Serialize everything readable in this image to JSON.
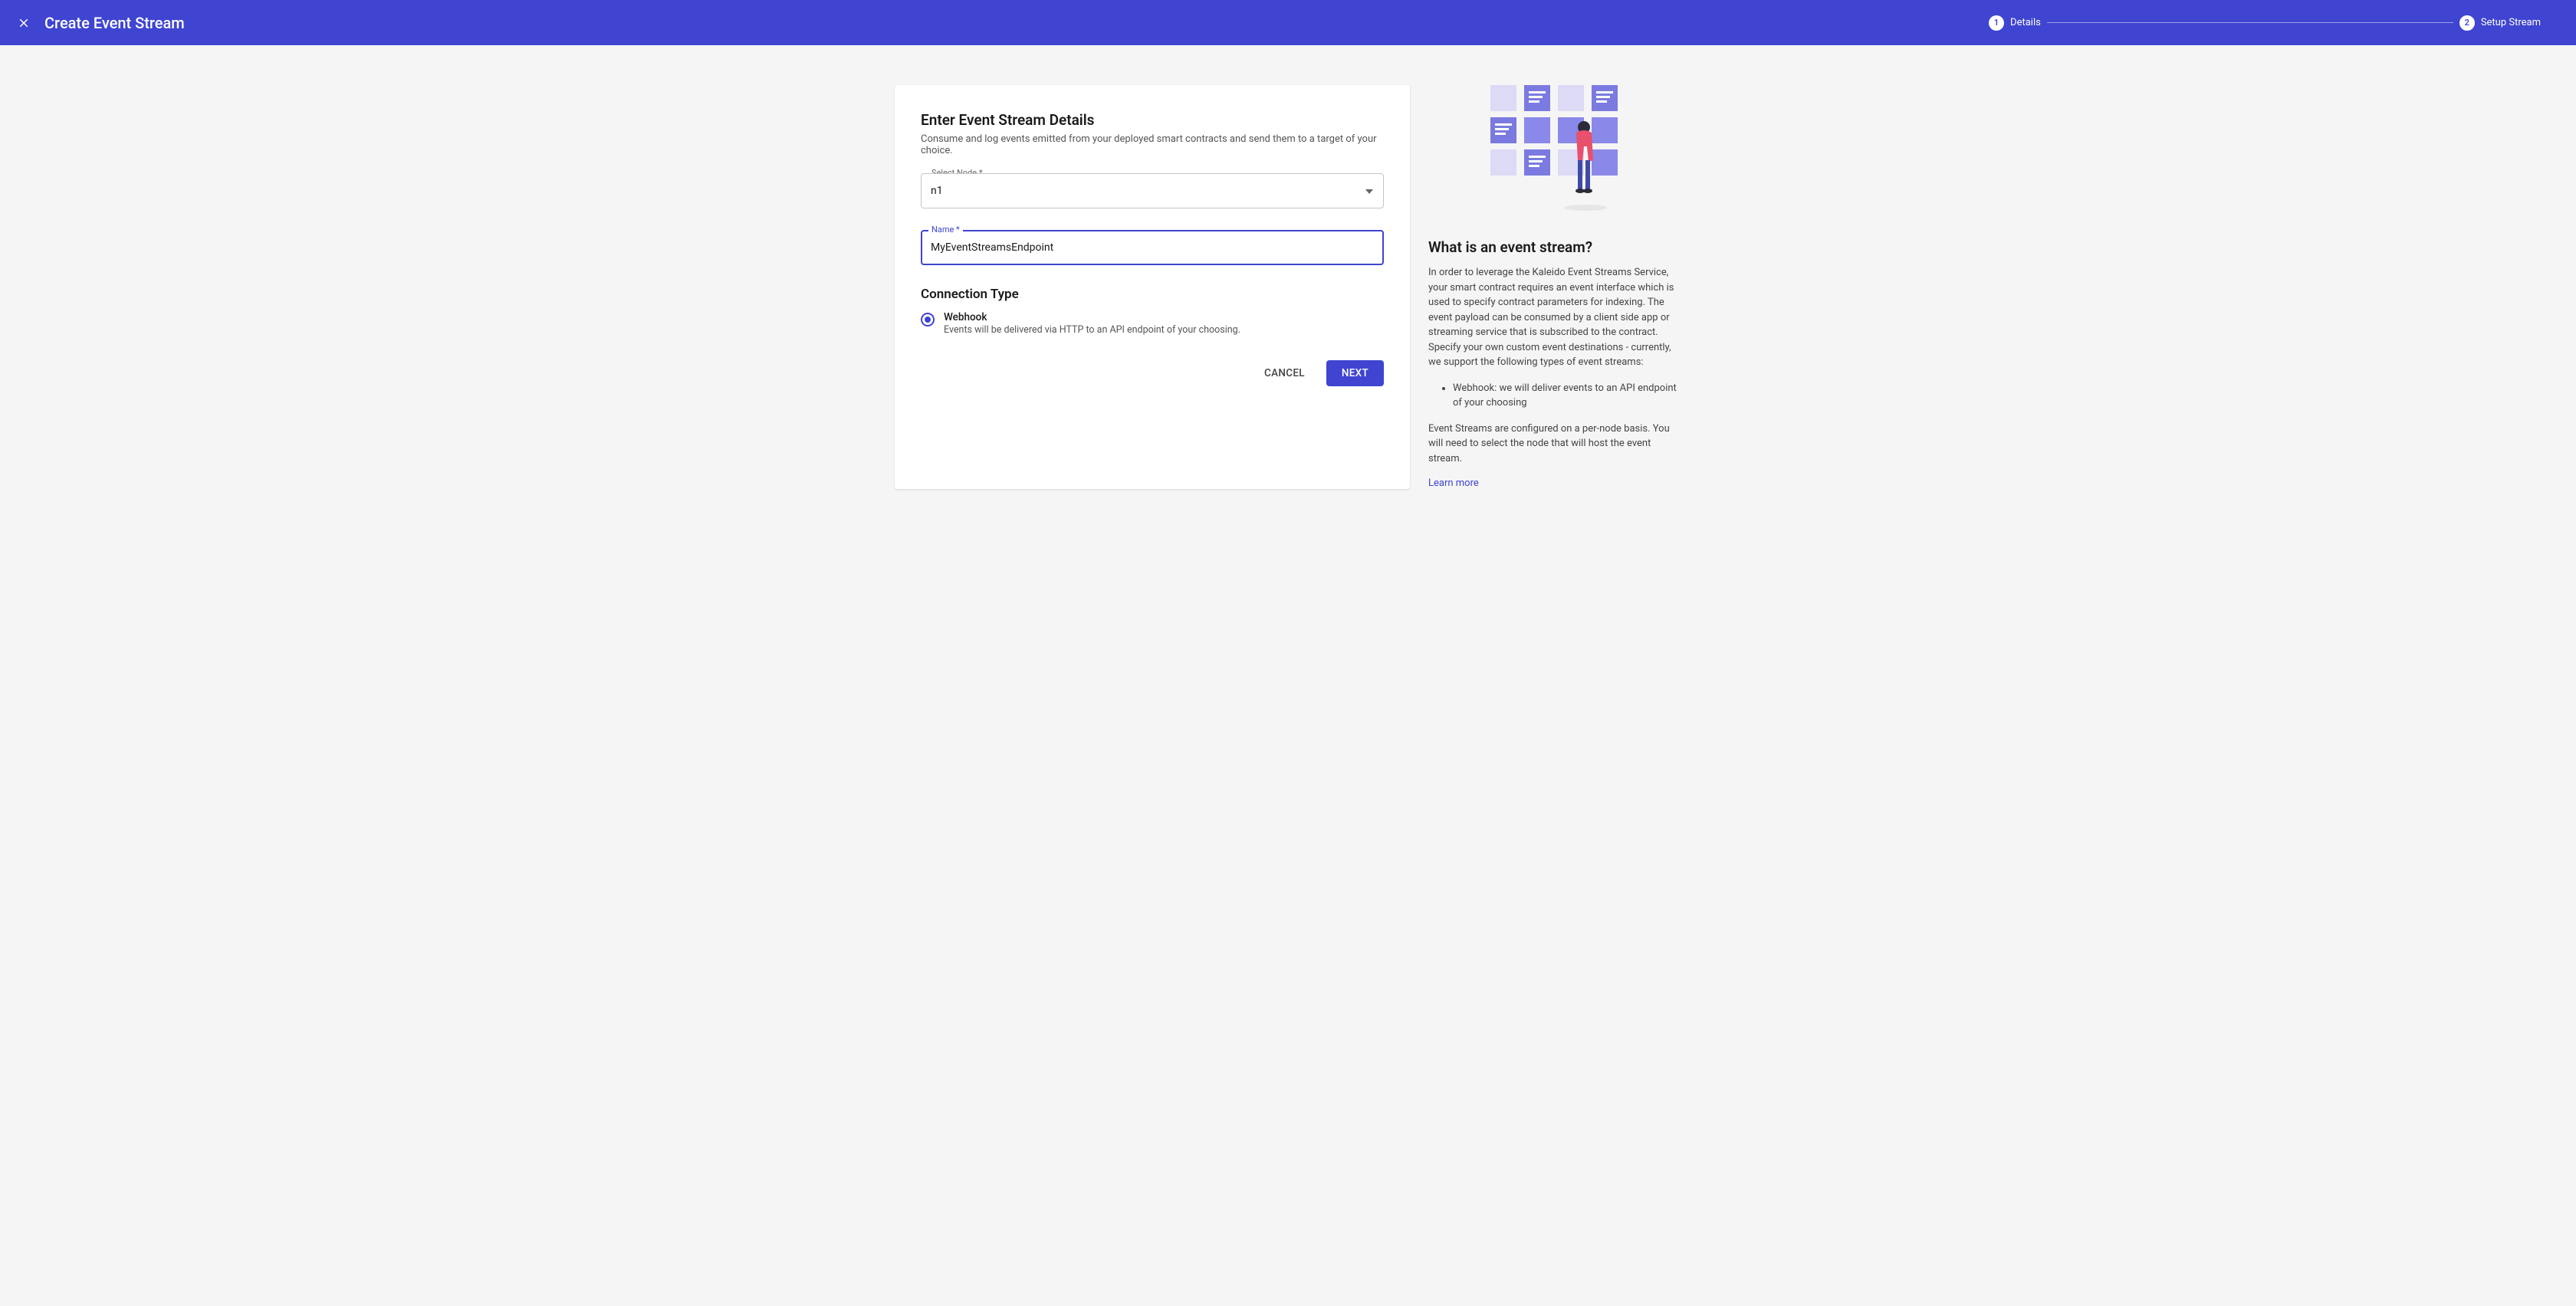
{
  "header": {
    "title": "Create Event Stream",
    "steps": [
      {
        "num": "1",
        "label": "Details"
      },
      {
        "num": "2",
        "label": "Setup Stream"
      }
    ]
  },
  "form": {
    "heading": "Enter Event Stream Details",
    "subheading": "Consume and log events emitted from your deployed smart contracts and send them to a target of your choice.",
    "select_node_label": "Select Node *",
    "select_node_value": "n1",
    "name_label": "Name *",
    "name_value": "MyEventStreamsEndpoint",
    "connection_type_heading": "Connection Type",
    "webhook_label": "Webhook",
    "webhook_desc": "Events will be delivered via HTTP to an API endpoint of your choosing.",
    "cancel": "CANCEL",
    "next": "NEXT"
  },
  "side": {
    "heading": "What is an event stream?",
    "p1": "In order to leverage the Kaleido Event Streams Service, your smart contract requires an event interface which is used to specify contract parameters for indexing. The event payload can be consumed by a client side app or streaming service that is subscribed to the contract. Specify your own custom event destinations - currently, we support the following types of event streams:",
    "bullet1": "Webhook: we will deliver events to an API endpoint of your choosing",
    "p2": "Event Streams are configured on a per-node basis. You will need to select the node that will host the event stream.",
    "learn_more": "Learn more"
  }
}
